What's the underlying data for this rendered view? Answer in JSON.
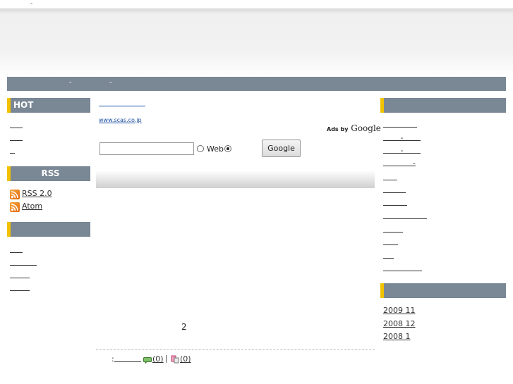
{
  "header": {
    "tiny_mark": "-"
  },
  "nav": {
    "items": [
      "-",
      "-"
    ]
  },
  "left": {
    "hot_title": "HOT",
    "hot_links": [
      "",
      "",
      ""
    ],
    "rss_title": "RSS",
    "rss_links": [
      "RSS 2.0",
      "Atom"
    ],
    "third_title": "",
    "third_links": [
      "",
      "",
      "",
      ""
    ]
  },
  "main": {
    "title_link": "",
    "ad_url": "www.scas.co.jp",
    "ads_by": "Ads by",
    "ads_brand": "Google",
    "search": {
      "value": "",
      "radio_web_label": "Web",
      "button_label": "Google"
    },
    "page_number": "2",
    "footer": {
      "prefix": ":",
      "comments": "(0)",
      "separator": "|",
      "trackbacks": "(0)"
    }
  },
  "right": {
    "top_title": "",
    "top_links": [
      "",
      "-",
      "-",
      "-",
      "",
      "",
      "",
      "",
      "",
      "",
      "",
      ""
    ],
    "archive_title": "",
    "archive_links": [
      "2009 11",
      "2008 12",
      "2008 1"
    ]
  }
}
